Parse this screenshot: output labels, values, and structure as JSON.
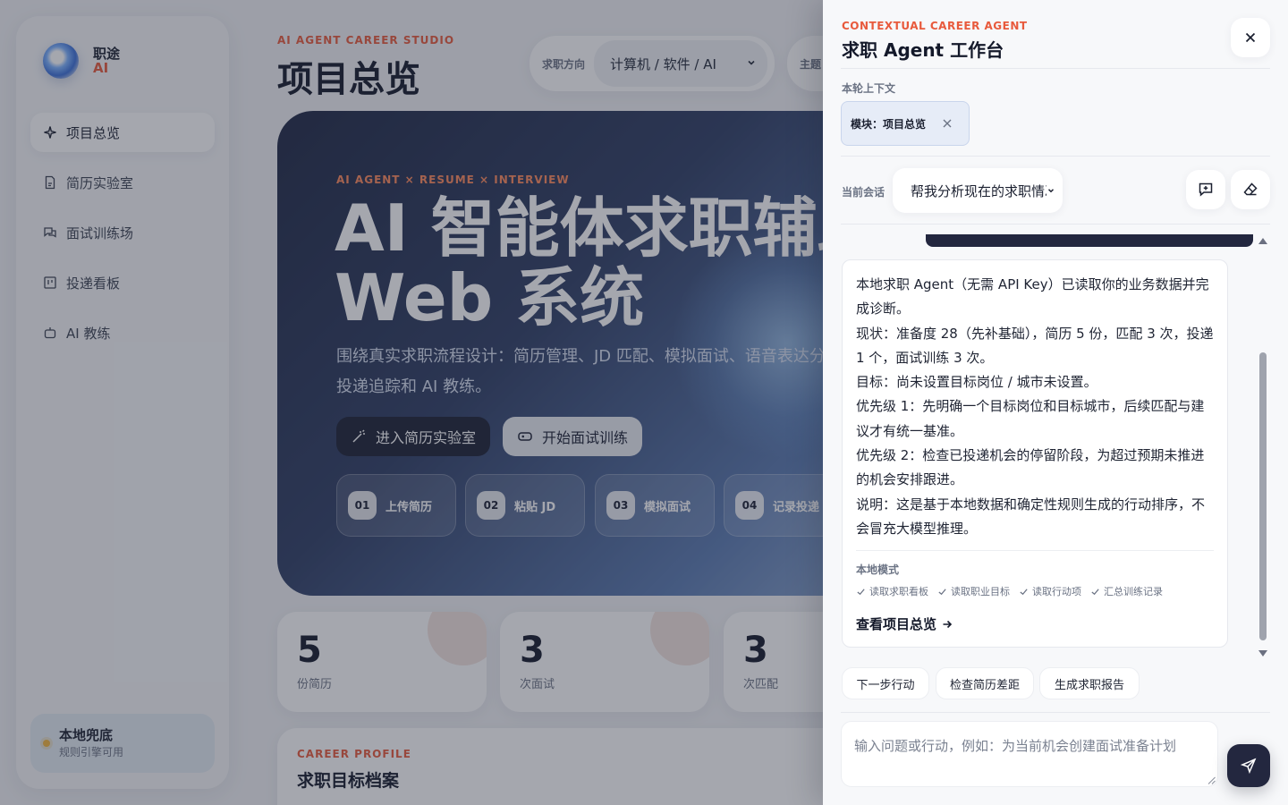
{
  "sidebar": {
    "brand_name": "职途",
    "brand_sub": "AI",
    "items": [
      {
        "label": "项目总览",
        "icon": "sparkle-icon",
        "active": true
      },
      {
        "label": "简历实验室",
        "icon": "file-icon"
      },
      {
        "label": "面试训练场",
        "icon": "chat-icon"
      },
      {
        "label": "投递看板",
        "icon": "board-icon"
      },
      {
        "label": "AI 教练",
        "icon": "bot-icon"
      }
    ],
    "local": {
      "title": "本地兜底",
      "subtitle": "规则引擎可用",
      "dot_color": "#f3b53b"
    }
  },
  "main": {
    "eyebrow": "AI AGENT CAREER STUDIO",
    "title": "项目总览",
    "filter": {
      "label": "求职方向",
      "value": "计算机 / 软件 / AI"
    },
    "filter2": {
      "label": "主题"
    },
    "hero": {
      "eyebrow": "AI AGENT × RESUME × INTERVIEW",
      "title": "AI 智能体求职辅助 Web 系统",
      "desc": "围绕真实求职流程设计：简历管理、JD 匹配、模拟面试、语音表达分析、投递追踪和 AI 教练。",
      "btn_primary": "进入简历实验室",
      "btn_secondary": "开始面试训练",
      "steps": [
        {
          "num": "01",
          "label": "上传简历"
        },
        {
          "num": "02",
          "label": "粘贴 JD"
        },
        {
          "num": "03",
          "label": "模拟面试"
        },
        {
          "num": "04",
          "label": "记录投递"
        }
      ]
    },
    "stats": [
      {
        "value": "5",
        "label": "份简历"
      },
      {
        "value": "3",
        "label": "次面试"
      },
      {
        "value": "3",
        "label": "次匹配"
      }
    ],
    "profile": {
      "eyebrow": "CAREER PROFILE",
      "title": "求职目标档案"
    }
  },
  "drawer": {
    "eyebrow": "CONTEXTUAL CAREER AGENT",
    "title": "求职 Agent 工作台",
    "context_label": "本轮上下文",
    "context_chip": "模块：项目总览",
    "session_label": "当前会话",
    "session_value": "帮我分析现在的求职情况",
    "message_lines": [
      "本地求职 Agent（无需 API Key）已读取你的业务数据并完成诊断。",
      "现状：准备度 28（先补基础），简历 5 份，匹配 3 次，投递 1 个，面试训练 3 次。",
      "目标：尚未设置目标岗位 / 城市未设置。",
      "优先级 1：先明确一个目标岗位和目标城市，后续匹配与建议才有统一基准。",
      "优先级 2：检查已投递机会的停留阶段，为超过预期未推进的机会安排跟进。",
      "说明：这是基于本地数据和确定性规则生成的行动排序，不会冒充大模型推理。"
    ],
    "mode_label": "本地模式",
    "checks": [
      "读取求职看板",
      "读取职业目标",
      "读取行动项",
      "汇总训练记录"
    ],
    "link": "查看项目总览",
    "quick_actions": [
      "下一步行动",
      "检查简历差距",
      "生成求职报告"
    ],
    "composer_placeholder": "输入问题或行动，例如：为当前机会创建面试准备计划"
  },
  "colors": {
    "accent": "#e85a3c",
    "dark": "#23273f"
  }
}
